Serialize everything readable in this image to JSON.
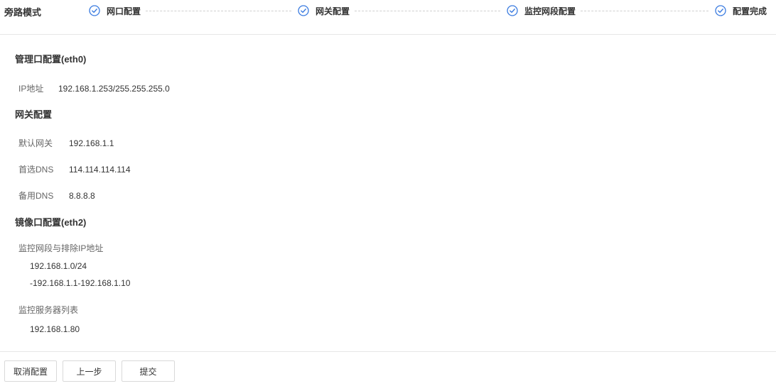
{
  "header": {
    "mode_title": "旁路模式",
    "steps": [
      {
        "label": "网口配置",
        "status": "done"
      },
      {
        "label": "网关配置",
        "status": "done"
      },
      {
        "label": "监控网段配置",
        "status": "done"
      },
      {
        "label": "配置完成",
        "status": "done"
      }
    ],
    "accent_color": "#3a7be0"
  },
  "mgmt": {
    "title": "管理口配置(eth0)",
    "ip_label": "IP地址",
    "ip_value": "192.168.1.253/255.255.255.0"
  },
  "gateway": {
    "title": "网关配置",
    "default_gw_label": "默认网关",
    "default_gw_value": "192.168.1.1",
    "dns1_label": "首选DNS",
    "dns1_value": "114.114.114.114",
    "dns2_label": "备用DNS",
    "dns2_value": "8.8.8.8"
  },
  "mirror": {
    "title": "镜像口配置(eth2)",
    "segments_label": "监控网段与排除IP地址",
    "segments": [
      "192.168.1.0/24",
      "-192.168.1.1-192.168.1.10"
    ],
    "servers_label": "监控服务器列表",
    "servers": [
      "192.168.1.80"
    ]
  },
  "footer": {
    "cancel_label": "取消配置",
    "prev_label": "上一步",
    "submit_label": "提交"
  }
}
